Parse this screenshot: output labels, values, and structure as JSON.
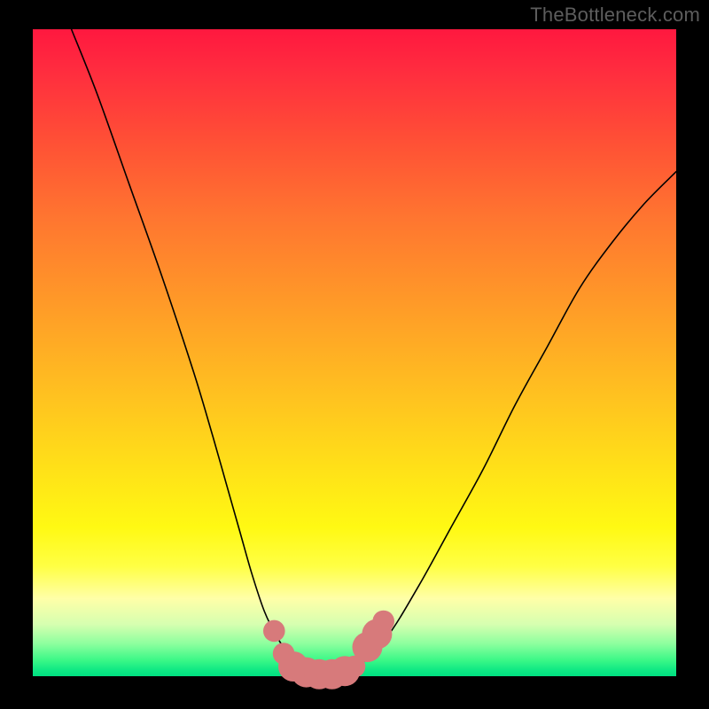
{
  "watermark": "TheBottleneck.com",
  "chart_data": {
    "type": "line",
    "title": "",
    "xlabel": "",
    "ylabel": "",
    "xlim": [
      0,
      100
    ],
    "ylim": [
      0,
      100
    ],
    "series": [
      {
        "name": "bottleneck-curve",
        "x": [
          6,
          10,
          15,
          20,
          25,
          28,
          30,
          32,
          34,
          36,
          38,
          40,
          42,
          44,
          46,
          48,
          50,
          55,
          60,
          65,
          70,
          75,
          80,
          85,
          90,
          95,
          100
        ],
        "y": [
          100,
          90,
          76,
          62,
          47,
          37,
          30,
          23,
          16,
          10,
          6,
          3,
          1,
          0,
          0,
          0,
          1,
          6,
          14,
          23,
          32,
          42,
          51,
          60,
          67,
          73,
          78
        ]
      }
    ],
    "markers": {
      "name": "highlight-dots",
      "color": "#d77a7b",
      "points": [
        {
          "x": 37.5,
          "y": 7,
          "r": 1.3
        },
        {
          "x": 39.0,
          "y": 3.5,
          "r": 1.3
        },
        {
          "x": 40.5,
          "y": 1.5,
          "r": 1.8
        },
        {
          "x": 42.5,
          "y": 0.6,
          "r": 1.8
        },
        {
          "x": 44.5,
          "y": 0.3,
          "r": 1.8
        },
        {
          "x": 46.5,
          "y": 0.3,
          "r": 1.8
        },
        {
          "x": 48.5,
          "y": 0.8,
          "r": 1.8
        },
        {
          "x": 50.0,
          "y": 1.5,
          "r": 1.3
        },
        {
          "x": 52.0,
          "y": 4.5,
          "r": 1.8
        },
        {
          "x": 53.5,
          "y": 6.5,
          "r": 1.8
        },
        {
          "x": 54.5,
          "y": 8.5,
          "r": 1.3
        }
      ]
    },
    "gradient_colors": {
      "top": "#ff183f",
      "mid_upper": "#ff9928",
      "mid": "#fff913",
      "mid_lower": "#ffffa8",
      "bottom": "#00e081"
    }
  }
}
